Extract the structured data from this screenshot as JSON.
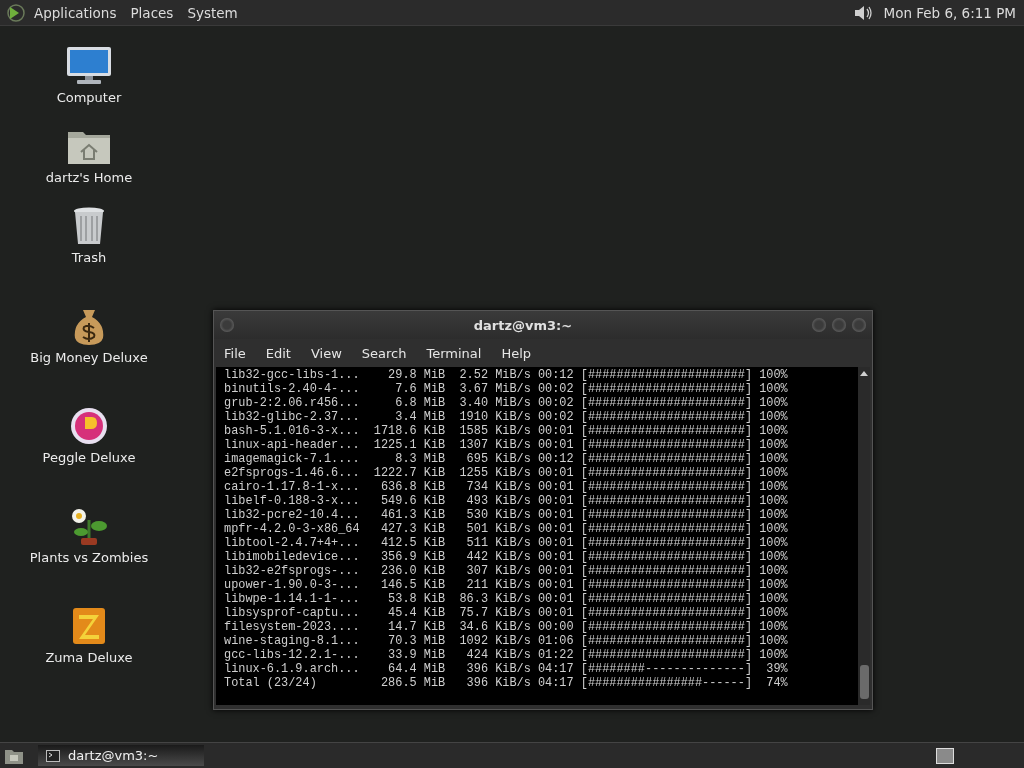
{
  "top_panel": {
    "menus": [
      "Applications",
      "Places",
      "System"
    ],
    "clock": "Mon Feb 6, 6:11 PM"
  },
  "desktop_icons": [
    {
      "kind": "computer",
      "label": "Computer"
    },
    {
      "kind": "home",
      "label": "dartz's Home"
    },
    {
      "kind": "trash",
      "label": "Trash"
    },
    {
      "kind": "moneybag",
      "label": "Big Money Deluxe"
    },
    {
      "kind": "ball",
      "label": "Peggle Deluxe"
    },
    {
      "kind": "flower",
      "label": "Plants vs Zombies"
    },
    {
      "kind": "letter",
      "label": "Zuma Deluxe"
    }
  ],
  "terminal": {
    "title": "dartz@vm3:~",
    "menu": [
      "File",
      "Edit",
      "View",
      "Search",
      "Terminal",
      "Help"
    ],
    "lines": [
      "lib32-gcc-libs-1...    29.8 MiB  2.52 MiB/s 00:12 [######################] 100%",
      "binutils-2.40-4-...     7.6 MiB  3.67 MiB/s 00:02 [######################] 100%",
      "grub-2:2.06.r456...     6.8 MiB  3.40 MiB/s 00:02 [######################] 100%",
      "lib32-glibc-2.37...     3.4 MiB  1910 KiB/s 00:02 [######################] 100%",
      "bash-5.1.016-3-x...  1718.6 KiB  1585 KiB/s 00:01 [######################] 100%",
      "linux-api-header...  1225.1 KiB  1307 KiB/s 00:01 [######################] 100%",
      "imagemagick-7.1....     8.3 MiB   695 KiB/s 00:12 [######################] 100%",
      "e2fsprogs-1.46.6...  1222.7 KiB  1255 KiB/s 00:01 [######################] 100%",
      "cairo-1.17.8-1-x...   636.8 KiB   734 KiB/s 00:01 [######################] 100%",
      "libelf-0.188-3-x...   549.6 KiB   493 KiB/s 00:01 [######################] 100%",
      "lib32-pcre2-10.4...   461.3 KiB   530 KiB/s 00:01 [######################] 100%",
      "mpfr-4.2.0-3-x86_64   427.3 KiB   501 KiB/s 00:01 [######################] 100%",
      "libtool-2.4.7+4+...   412.5 KiB   511 KiB/s 00:01 [######################] 100%",
      "libimobiledevice...   356.9 KiB   442 KiB/s 00:01 [######################] 100%",
      "lib32-e2fsprogs-...   236.0 KiB   307 KiB/s 00:01 [######################] 100%",
      "upower-1.90.0-3-...   146.5 KiB   211 KiB/s 00:01 [######################] 100%",
      "libwpe-1.14.1-1-...    53.8 KiB  86.3 KiB/s 00:01 [######################] 100%",
      "libsysprof-captu...    45.4 KiB  75.7 KiB/s 00:01 [######################] 100%",
      "filesystem-2023....    14.7 KiB  34.6 KiB/s 00:00 [######################] 100%",
      "wine-staging-8.1...    70.3 MiB  1092 KiB/s 01:06 [######################] 100%",
      "gcc-libs-12.2.1-...    33.9 MiB   424 KiB/s 01:22 [######################] 100%",
      "linux-6.1.9.arch...    64.4 MiB   396 KiB/s 04:17 [########--------------]  39%",
      "Total (23/24)         286.5 MiB   396 KiB/s 04:17 [################------]  74%"
    ]
  },
  "taskbar": {
    "windows": [
      {
        "label": "dartz@vm3:~",
        "selected": true
      }
    ]
  }
}
